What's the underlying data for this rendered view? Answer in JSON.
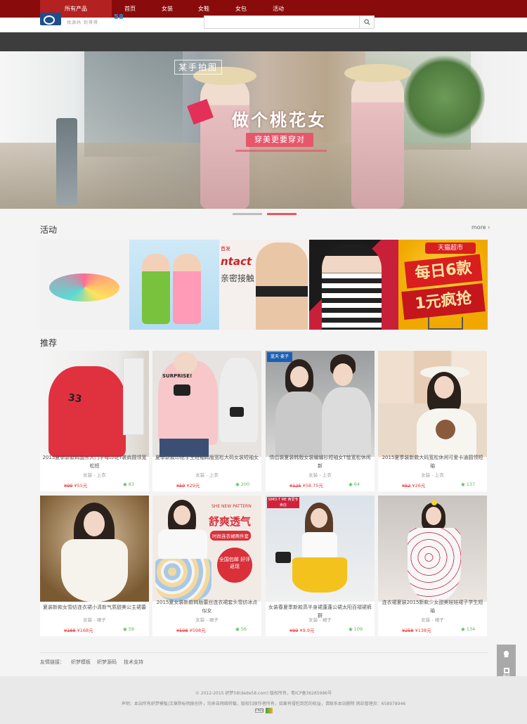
{
  "nav": {
    "items": [
      "所有产品",
      "首页",
      "女装",
      "女鞋",
      "女包",
      "活动"
    ]
  },
  "header": {
    "logo_text": "找源码 到得得",
    "logo_deco": "58",
    "search_placeholder": ""
  },
  "banner": {
    "tag": "某手拍图",
    "title": "做个桃花女",
    "subtitle": "穿美更要穿对"
  },
  "activity": {
    "title": "活动",
    "more": "more ›",
    "tile3": {
      "note": "首发",
      "title": "ntact",
      "sub": "亲密接触"
    },
    "tile5": {
      "top": "天猫超市",
      "line1": "每日6款",
      "line2": "1元疯抢"
    }
  },
  "recommend": {
    "title": "推荐",
    "products": [
      {
        "name": "2015夏季新款韩国东大门字母印花T裹肩圆领宽松短",
        "category": "女装 - 上衣",
        "old_price": "¥99",
        "price": "¥55元",
        "views": "83"
      },
      {
        "name": "夏季新款印花字生短袖韩版宽松大码女装短袖女",
        "category": "女装 - 上衣",
        "old_price": "¥59",
        "price": "¥29元",
        "views": "200"
      },
      {
        "name": "情侣装夏装韩版女装编编衫短袖女T恤宽松休闲新",
        "category": "女装 - 上衣",
        "old_price": "¥125",
        "price": "¥58.75元",
        "views": "64"
      },
      {
        "name": "2015夏季装新款大码宽松休闲可爱卡通圆领短袖",
        "category": "女装 - 上衣",
        "old_price": "¥52",
        "price": "¥26元",
        "views": "137"
      },
      {
        "name": "夏装新款女雪纺连衣裙小清新气质甜美公主裙蕾",
        "category": "女装 - 裙子",
        "old_price": "¥188",
        "price": "¥168元",
        "views": "58"
      },
      {
        "name": "2015夏女装新款韩版蕾丝连衣裙套头雪纺冰点似女",
        "category": "女装 - 裙子",
        "old_price": "¥598",
        "price": "¥598元",
        "views": "56"
      },
      {
        "name": "女装春夏季新款高半身裙蓬蓬公裙太阳百褶裙裤群",
        "category": "女装 - 裙子",
        "old_price": "¥99",
        "price": "¥9.9元",
        "views": "109"
      },
      {
        "name": "连衣裙夏装2015新款少女甜美娃娃裙子学生短袖",
        "category": "女装 - 裙子",
        "old_price": "¥258",
        "price": "¥138元",
        "views": "134"
      }
    ]
  },
  "product_art": {
    "p2_text": "SURPRISE!",
    "p3_label": "蓝天·麦子",
    "p6_line1": "SHE NEW PATTERN",
    "p6_line2": "舒爽透气",
    "p6_line3": "时尚连衣裙两件套",
    "p6_badge": "全国包邮 好评返现",
    "p7_label": "SIMO-T ME 西爱专卖店"
  },
  "float_buttons": {
    "b1": "",
    "b2": "置顶",
    "b3": "▲"
  },
  "links": {
    "label": "友情链接：",
    "items": [
      "织梦模板",
      "织梦源码",
      "技术支持"
    ]
  },
  "footer": {
    "copyright": "© 2012-2015 织梦58(dede58.com) 版权所有，粤ICP备36265986号",
    "notice": "声明：本站所有织梦模板/文章除标明原创外，均来自网络转载，版权归原作者所有，如果有侵犯到您的权益，请联系本站删除 网站管理员：658978946",
    "badge": "CNZZ"
  }
}
